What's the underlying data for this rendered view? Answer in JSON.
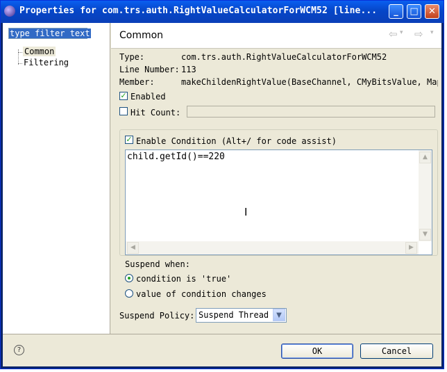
{
  "window": {
    "title": "Properties for com.trs.auth.RightValueCalculatorForWCM52 [line..."
  },
  "filter": {
    "placeholder": "type filter text"
  },
  "tree": {
    "items": [
      {
        "label": "Common",
        "selected": true
      },
      {
        "label": "Filtering",
        "selected": false
      }
    ]
  },
  "page": {
    "title": "Common"
  },
  "details": {
    "type_label": "Type:",
    "type_value": "com.trs.auth.RightValueCalculatorForWCM52",
    "line_label": "Line Number:",
    "line_value": "113",
    "member_label": "Member:",
    "member_value": "makeChildenRightValue(BaseChannel, CMyBitsValue, Map)"
  },
  "enabled": {
    "label": "Enabled",
    "checked": true
  },
  "hit_count": {
    "label": "Hit Count:",
    "checked": false,
    "value": ""
  },
  "condition": {
    "label": "Enable Condition (Alt+/ for code assist)",
    "checked": true,
    "code": "child.getId()==220"
  },
  "suspend_when": {
    "label": "Suspend when:",
    "options": [
      {
        "label": "condition is 'true'",
        "selected": true
      },
      {
        "label": "value of condition changes",
        "selected": false
      }
    ]
  },
  "suspend_policy": {
    "label": "Suspend Policy:",
    "value": "Suspend Thread"
  },
  "buttons": {
    "ok": "OK",
    "cancel": "Cancel"
  },
  "icons": {
    "back": "back-arrow-icon",
    "forward": "forward-arrow-icon",
    "help": "help-icon",
    "minimize": "minimize-icon",
    "maximize": "maximize-icon",
    "close": "close-icon"
  }
}
